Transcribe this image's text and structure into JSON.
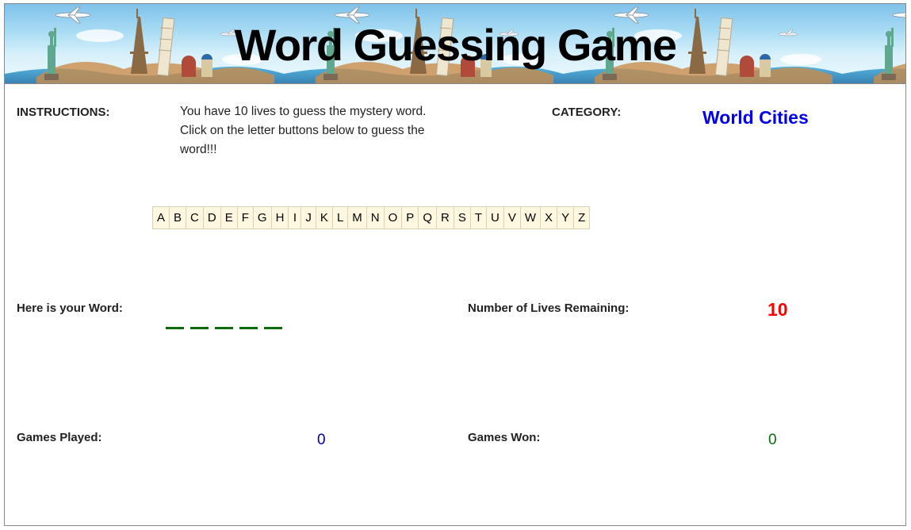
{
  "header": {
    "title": "Word Guessing Game"
  },
  "instructions": {
    "label": "INSTRUCTIONS:",
    "line1": "You have 10 lives to guess the mystery word.",
    "line2": "Click on the letter buttons below to guess the",
    "line3": "word!!!"
  },
  "category": {
    "label": "CATEGORY:",
    "value": "World Cities"
  },
  "letters": [
    "A",
    "B",
    "C",
    "D",
    "E",
    "F",
    "G",
    "H",
    "I",
    "J",
    "K",
    "L",
    "M",
    "N",
    "O",
    "P",
    "Q",
    "R",
    "S",
    "T",
    "U",
    "V",
    "W",
    "X",
    "Y",
    "Z"
  ],
  "word": {
    "label": "Here is your Word:",
    "blank_count": 5
  },
  "lives": {
    "label": "Number of Lives Remaining:",
    "value": "10"
  },
  "stats": {
    "played_label": "Games Played:",
    "played_value": "0",
    "won_label": "Games Won:",
    "won_value": "0"
  },
  "colors": {
    "category": "#0000ee",
    "lives": "#ff0000",
    "played": "#000099",
    "won": "#0a6b0a",
    "letter_bg": "#fff8e1"
  }
}
